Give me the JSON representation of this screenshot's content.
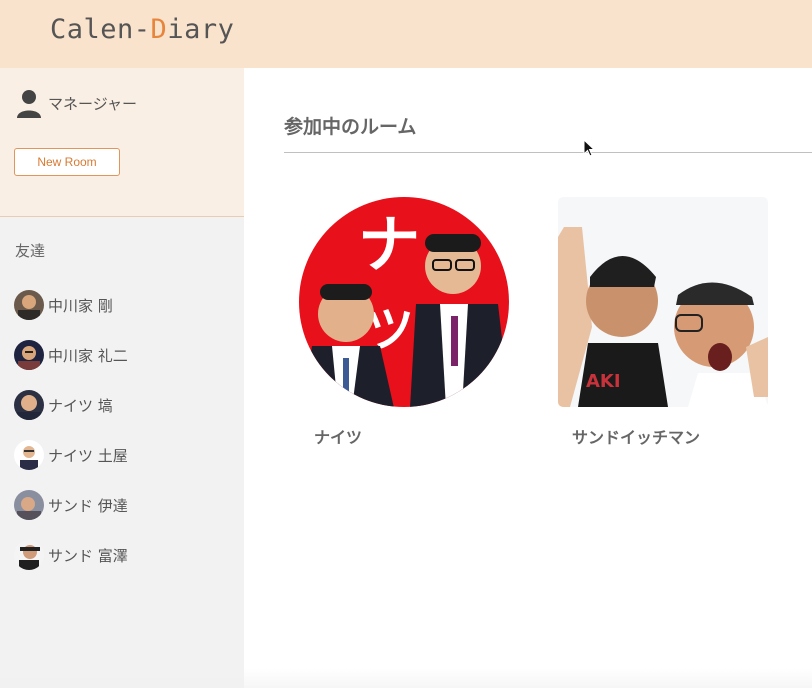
{
  "header": {
    "logo_part1": "Calen-",
    "logo_accent": "D",
    "logo_part2": "iary",
    "brand_color": "#fae3cc",
    "accent_color": "#e8853c"
  },
  "sidebar": {
    "user_label": "マネージャー",
    "new_room_label": "New Room",
    "friends_title": "友達",
    "friends": [
      {
        "name": "中川家 剛"
      },
      {
        "name": "中川家 礼二"
      },
      {
        "name": "ナイツ 塙"
      },
      {
        "name": "ナイツ 土屋"
      },
      {
        "name": "サンド 伊達"
      },
      {
        "name": "サンド 富澤"
      }
    ]
  },
  "main": {
    "section_title": "参加中のルーム",
    "rooms": [
      {
        "name": "ナイツ",
        "icon": "knights-photo"
      },
      {
        "name": "サンドイッチマン",
        "icon": "sandwichman-photo"
      }
    ]
  }
}
